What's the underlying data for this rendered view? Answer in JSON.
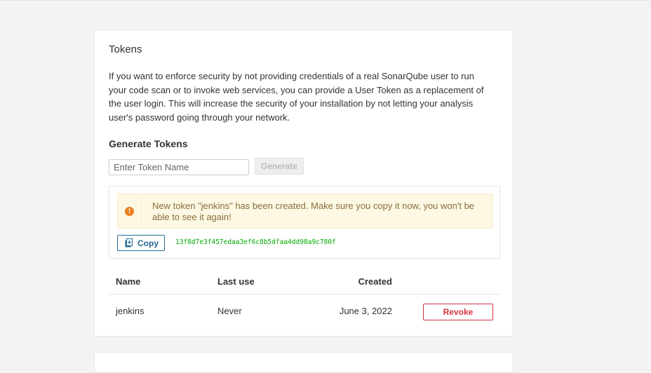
{
  "tokens": {
    "title": "Tokens",
    "description": "If you want to enforce security by not providing credentials of a real SonarQube user to run your code scan or to invoke web services, you can provide a User Token as a replacement of the user login. This will increase the security of your installation by not letting your analysis user's password going through your network.",
    "generate_title": "Generate Tokens",
    "input_placeholder": "Enter Token Name",
    "input_value": "",
    "generate_label": "Generate",
    "alert_icon": "exclamation-circle-icon",
    "alert_text": "New token \"jenkins\" has been created. Make sure you copy it now, you won't be able to see it again!",
    "copy_label": "Copy",
    "copy_icon": "clipboard-icon",
    "token_value": "13f8d7e3f457edaa3ef6c8b5dfaa4dd98a9c780f",
    "columns": {
      "name": "Name",
      "last_use": "Last use",
      "created": "Created"
    },
    "rows": [
      {
        "name": "jenkins",
        "last_use": "Never",
        "created": "June 3, 2022",
        "action": "Revoke"
      }
    ]
  },
  "colors": {
    "page_bg": "#f3f3f3",
    "alert_bg": "#fcf8e3",
    "warning_icon": "#ed7d20",
    "copy_blue": "#236a97",
    "token_green": "#00aa00",
    "revoke_red": "#d4333f"
  }
}
